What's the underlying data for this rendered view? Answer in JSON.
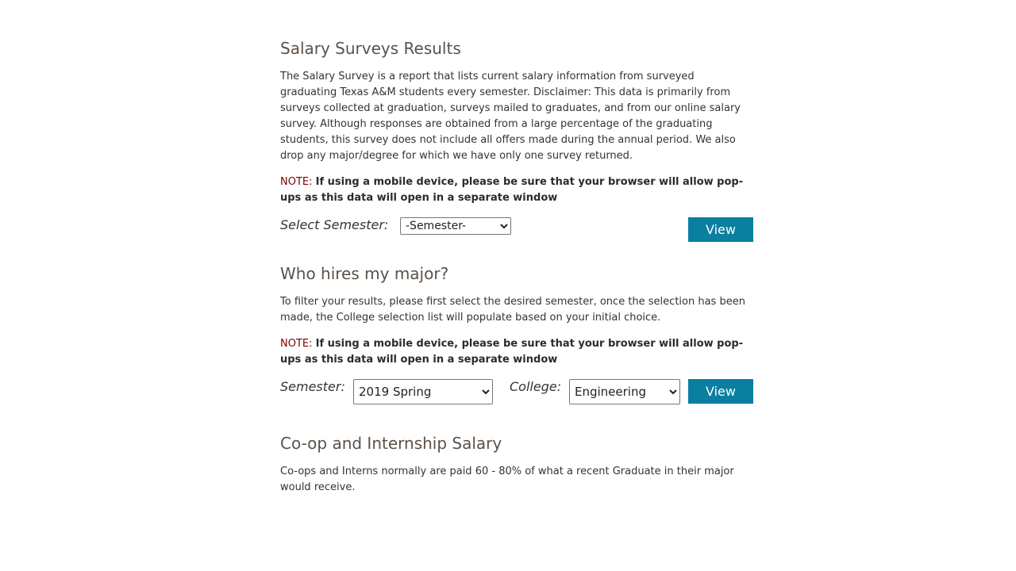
{
  "salary": {
    "title": "Salary Surveys Results",
    "description": "The Salary Survey is a report that lists current salary information from surveyed graduating Texas A&M students every semester. Disclaimer: This data is primarily from surveys collected at graduation, surveys mailed to graduates, and from our online salary survey. Although responses are obtained from a large percentage of the graduating students, this survey does not include all offers made during the annual period. We also drop any major/degree for which we have only one survey returned.",
    "note_label": "NOTE:",
    "note_text": "If using a mobile device, please be sure that your browser will allow pop-ups as this data will open in a separate window",
    "semester_label": "Select Semester:",
    "semester_value": "-Semester-",
    "view_label": "View"
  },
  "hires": {
    "title": "Who hires my major?",
    "description": "To filter your results, please first select the desired semester, once the selection has been made, the College selection list will populate based on your initial choice.",
    "note_label": "NOTE:",
    "note_text": "If using a mobile device, please be sure that your browser will allow pop-ups as this data will open in a separate window",
    "semester_label": "Semester:",
    "semester_value": "2019 Spring",
    "college_label": "College:",
    "college_value": "Engineering",
    "view_label": "View"
  },
  "coop": {
    "title": "Co-op and Internship Salary",
    "description": "Co-ops and Interns normally are paid 60 - 80% of what a recent Graduate in their major would receive."
  },
  "colors": {
    "heading": "#5c5148",
    "note_label": "#7a0000",
    "button": "#0a7fa0"
  }
}
